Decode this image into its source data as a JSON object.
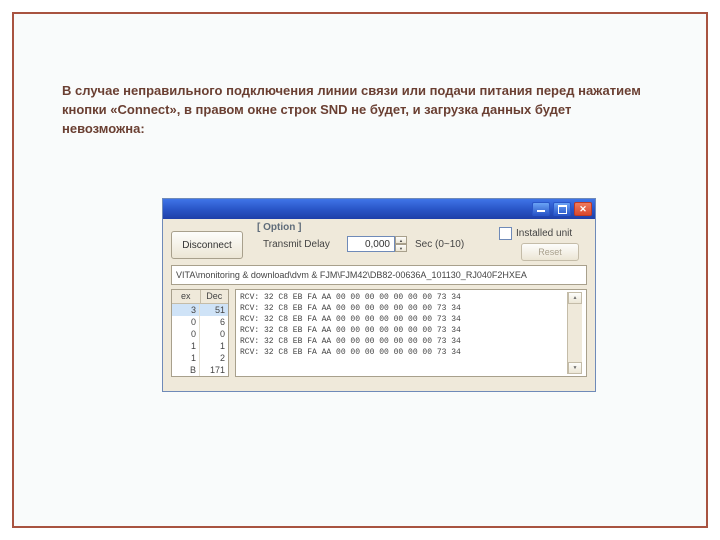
{
  "caption": "В случае неправильного подключения линии связи или подачи питания перед нажатием кнопки «Connect», в правом окне строк SND не будет, и загрузка данных будет невозможна:",
  "window": {
    "option_legend": "[ Option ]",
    "disconnect_label": "Disconnect",
    "transmit_delay_label": "Transmit Delay",
    "delay_value": "0,000",
    "sec_label": "Sec (0~10)",
    "installed_label": "Installed unit",
    "reset_label": "Reset",
    "path_text": "VITA\\monitoring & download\\dvm & FJM\\FJM42\\DB82-00636A_101130_RJ040F2HXEA"
  },
  "table": {
    "header1": "ex",
    "header2": "Dec",
    "rows": [
      {
        "c1": "3",
        "c2": "51"
      },
      {
        "c1": "0",
        "c2": "6"
      },
      {
        "c1": "0",
        "c2": "0"
      },
      {
        "c1": "1",
        "c2": "1"
      },
      {
        "c1": "1",
        "c2": "2"
      },
      {
        "c1": "B",
        "c2": "171"
      }
    ]
  },
  "log_line": "RCV: 32 C8 EB FA AA 00 00 00 00 00 00 00 73 34",
  "log_count": 6,
  "glyphs": {
    "close": "✕",
    "up": "▲",
    "down": "▼"
  }
}
